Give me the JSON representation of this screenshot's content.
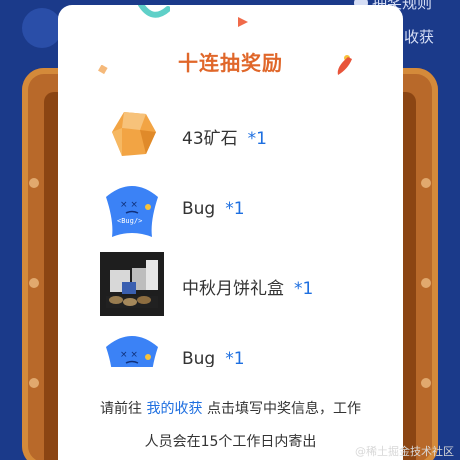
{
  "background": {
    "rules_label": "抽奖规则",
    "harvest_label": "收获"
  },
  "modal": {
    "title": "十连抽奖励",
    "prizes": [
      {
        "name": "43矿石",
        "qty": "*1",
        "icon": "ore-icon"
      },
      {
        "name": "Bug",
        "qty": "*1",
        "icon": "bug-icon"
      },
      {
        "name": "中秋月饼礼盒",
        "qty": "*1",
        "icon": "mooncake-gift-box-icon"
      },
      {
        "name": "Bug",
        "qty": "*1",
        "icon": "bug-icon"
      }
    ],
    "notice": {
      "prefix": "请前往",
      "link": "我的收获",
      "middle": "点击填写中奖信息，工作",
      "line2": "人员会在15个工作日内寄出"
    }
  },
  "watermark": "@稀土掘金技术社区",
  "colors": {
    "title": "#e0672a",
    "link": "#1e6fe0",
    "background": "#1b3a8a",
    "bug": "#3b82f6",
    "ore": "#f0a040"
  }
}
